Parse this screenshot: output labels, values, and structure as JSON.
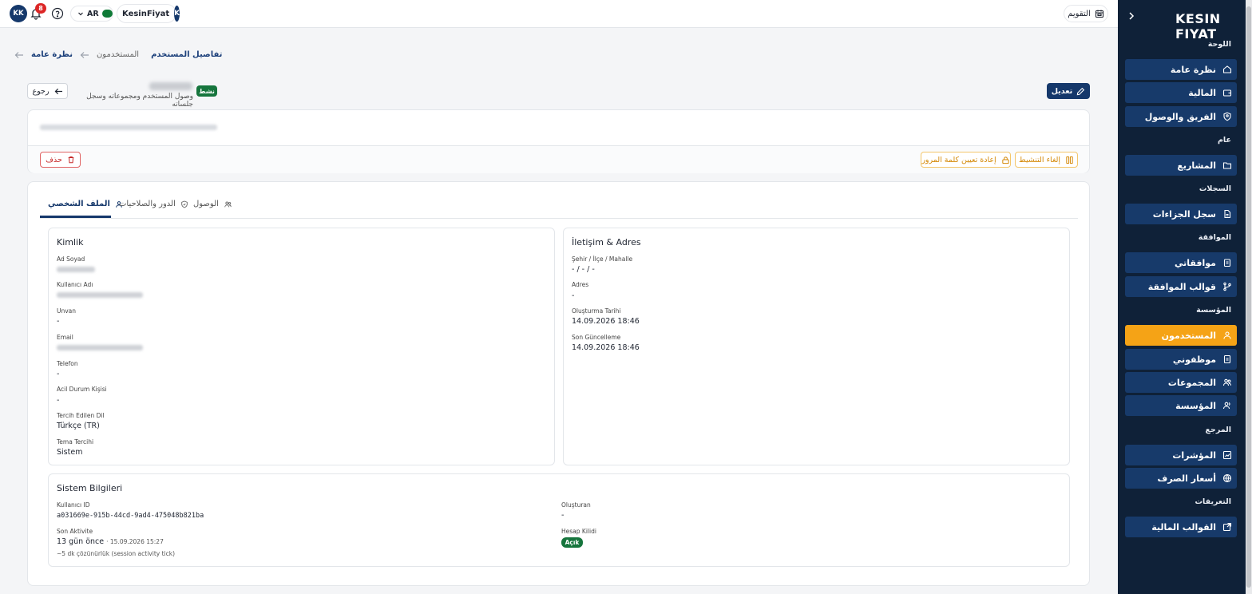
{
  "topbar": {
    "user_initials": "KK",
    "notification_count": "8",
    "language": "AR",
    "org_name": "KesinFiyat",
    "org_initial": "K",
    "calendar_label": "التقويم"
  },
  "sidebar": {
    "logo": "KESIN FIYAT",
    "sections": {
      "dashboard": "اللوحة",
      "general": "عام",
      "records": "السجلات",
      "approval": "الموافقة",
      "organization": "المؤسسة",
      "reference": "المرجع",
      "definitions": "التعريفات"
    },
    "items": {
      "overview": "نظرة عامة",
      "finance": "المالية",
      "team_access": "الفريق والوصول",
      "projects": "المشاريع",
      "penalty_log": "سجل الجزاءات",
      "my_approvals": "موافقاتي",
      "approval_templates": "قوالب الموافقة",
      "users": "المستخدمون",
      "my_employees": "موظفوني",
      "groups": "المجموعات",
      "organization": "المؤسسة",
      "indicators": "المؤشرات",
      "exchange_rates": "أسعار الصرف",
      "financial_templates": "القوالب المالية"
    }
  },
  "breadcrumb": {
    "root": "نظرة عامة",
    "users": "المستخدمون",
    "current": "تفاصيل المستخدم"
  },
  "header": {
    "back": "رجوع",
    "status": "نشط",
    "subtitle": "وصول المستخدم ومجموعاته وسجل جلساته",
    "edit": "تعديل"
  },
  "actions": {
    "delete": "حذف",
    "reset_password": "إعادة تعيين كلمة المرور",
    "deactivate": "إلغاء التنشيط"
  },
  "tabs": {
    "profile": "الملف الشخصي",
    "roles": "الدور والصلاحيات",
    "access": "الوصول"
  },
  "identity": {
    "title": "Kimlik",
    "full_name_label": "Ad Soyad",
    "username_label": "Kullanıcı Adı",
    "title_label": "Unvan",
    "title_value": "-",
    "email_label": "Email",
    "phone_label": "Telefon",
    "phone_value": "-",
    "emergency_label": "Acil Durum Kişisi",
    "emergency_value": "-",
    "language_label": "Tercih Edilen Dil",
    "language_value": "Türkçe (TR)",
    "theme_label": "Tema Tercihi",
    "theme_value": "Sistem"
  },
  "contact": {
    "title": "İletişim & Adres",
    "city_label": "Şehir / İlçe / Mahalle",
    "city_value": "- / - / -",
    "address_label": "Adres",
    "address_value": "-",
    "created_label": "Oluşturma Tarihi",
    "created_value": "14.09.2026 18:46",
    "updated_label": "Son Güncelleme",
    "updated_value": "14.09.2026 18:46"
  },
  "system": {
    "title": "Sistem Bilgileri",
    "user_id_label": "Kullanıcı ID",
    "user_id_value": "a031669e-915b-44cd-9ad4-475048b821ba",
    "created_by_label": "Oluşturan",
    "created_by_value": "-",
    "last_activity_label": "Son Aktivite",
    "last_activity_value": "13 gün önce",
    "last_activity_time": "· 15.09.2026 15:27",
    "resolution_note": "~5 dk çözünürlük (session activity tick)",
    "lock_label": "Hesap Kilidi",
    "lock_value": "Açık"
  },
  "colors": {
    "navy": "#15386b",
    "sidebar_bg": "#0f2138",
    "active_orange": "#f5a316",
    "success_green": "#16753d",
    "danger_red": "#c62828",
    "warning_amber": "#d48806"
  }
}
